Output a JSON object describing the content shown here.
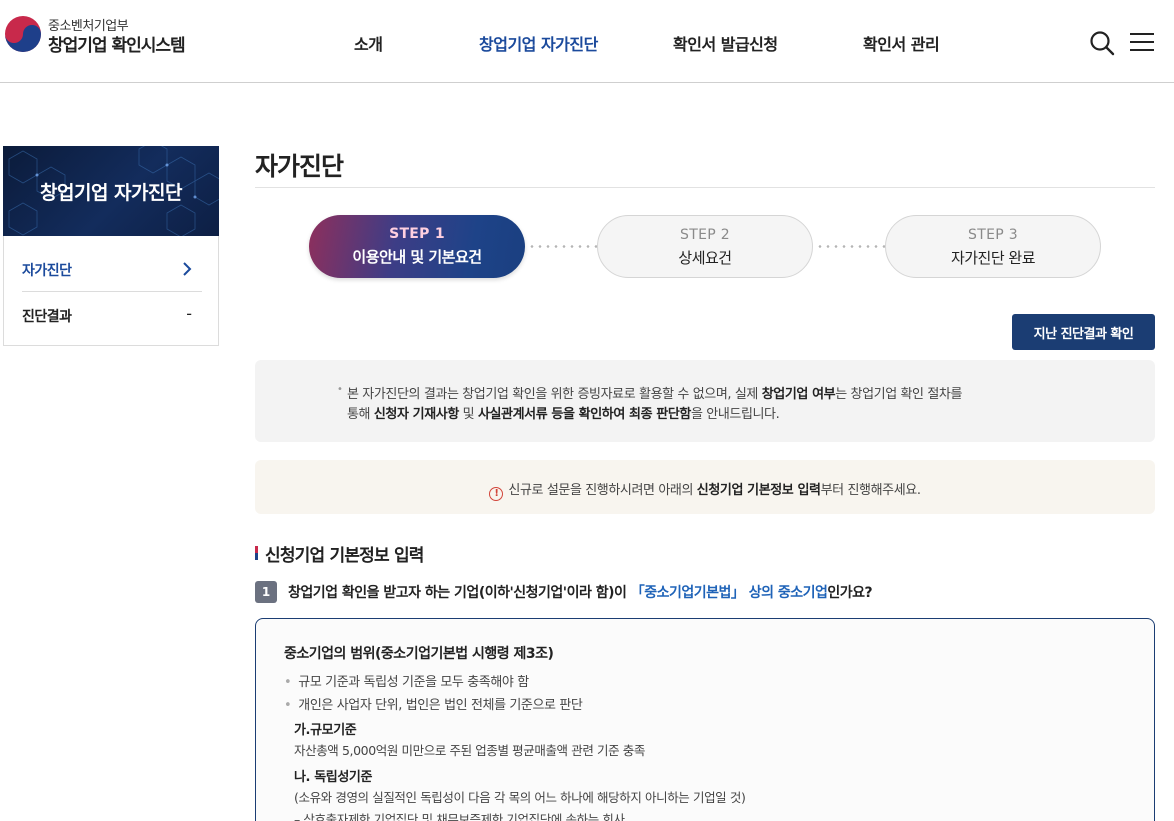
{
  "header": {
    "logo_sub": "중소벤처기업부",
    "logo_main": "창업기업 확인시스템",
    "nav": [
      "소개",
      "창업기업 자가진단",
      "확인서 발급신청",
      "확인서 관리"
    ]
  },
  "sidebar": {
    "banner_title": "창업기업 자가진단",
    "items": [
      {
        "label": "자가진단",
        "mark": "›"
      },
      {
        "label": "진단결과",
        "mark": "-"
      }
    ]
  },
  "main": {
    "page_title": "자가진단",
    "steps": [
      {
        "num": "STEP 1",
        "label": "이용안내 및 기본요건"
      },
      {
        "num": "STEP 2",
        "label": "상세요건"
      },
      {
        "num": "STEP 3",
        "label": "자가진단 완료"
      }
    ],
    "history_button": "지난 진단결과 확인",
    "notice": {
      "l1_a": "본 자가진단의 결과는 창업기업 확인을 위한 증빙자료로 활용할 수 없으며, 실제 ",
      "l1_b": "창업기업 여부",
      "l1_c": "는 창업기업 확인 절차를",
      "l2_a": "통해 ",
      "l2_b": "신청자 기재사항",
      "l2_c": " 및 ",
      "l2_d": "사실관계서류 등을 확인하여 최종 판단함",
      "l2_e": "을 안내드립니다."
    },
    "warning": {
      "a": "신규로 설문을 진행하시려면 아래의 ",
      "b": "신청기업 기본정보 입력",
      "c": "부터 진행해주세요."
    },
    "section_title": "신청기업 기본정보 입력",
    "question": {
      "num": "1",
      "a": "창업기업 확인을 받고자 하는 기업(이하'신청기업'이라 함)이 ",
      "link": "「중소기업기본법」 상의 중소기업",
      "b": "인가요?"
    },
    "info": {
      "title": "중소기업의 범위(중소기업기본법 시행령 제3조)",
      "bullets": [
        "규모 기준과 독립성 기준을 모두 충족해야 함",
        "개인은 사업자 단위, 법인은 법인 전체를 기준으로 판단"
      ],
      "sub1": "가.규모기준",
      "sub1_text": "자산총액 5,000억원 미만으로 주된 업종별 평균매출액 관련 기준 충족",
      "sub2": "나. 독립성기준",
      "sub2_text": "(소유와 경영의 실질적인 독립성이 다음 각 목의 어느 하나에 해당하지 아니하는 기업일 것)",
      "sub2_item": "– 상호출자제한 기업집단 및 채무보증제한 기업집단에 속하는 회사"
    }
  }
}
